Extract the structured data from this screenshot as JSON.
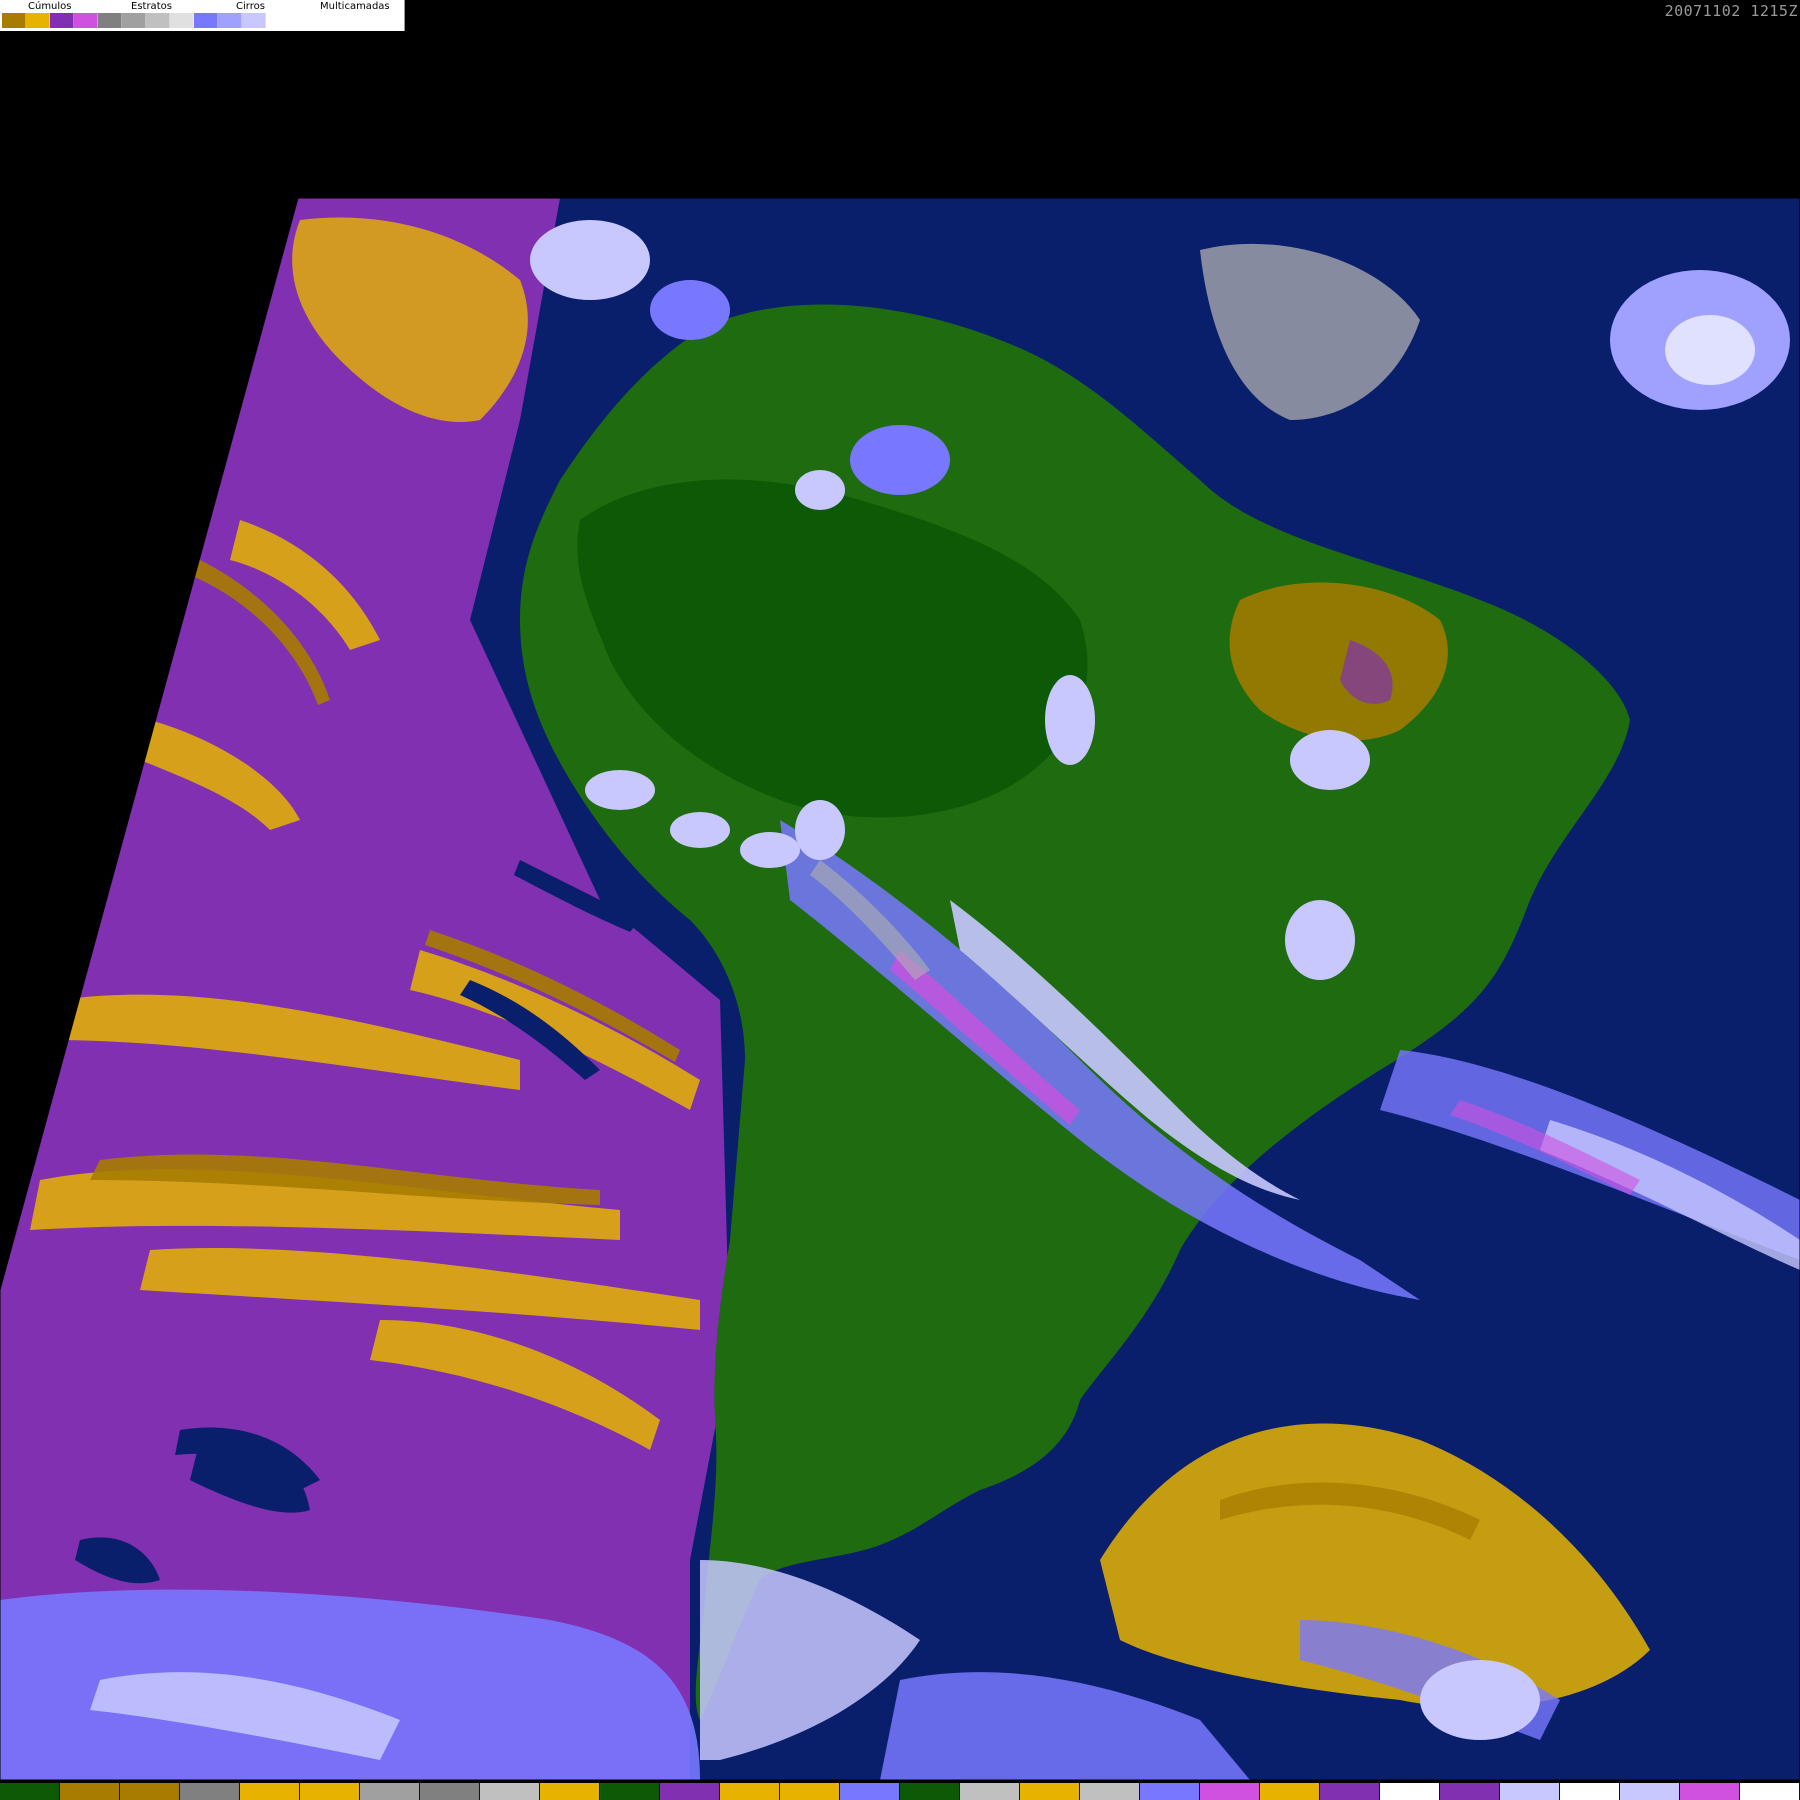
{
  "legend": {
    "groups": [
      {
        "label": "Cúmulos",
        "label_key": "cumulos"
      },
      {
        "label": "Estratos",
        "label_key": "estratos"
      },
      {
        "label": "Cirros",
        "label_key": "cirros"
      },
      {
        "label": "Multicamadas",
        "label_key": "multicamadas"
      }
    ],
    "swatches": [
      {
        "category": "cumulos",
        "color": "#a77c00"
      },
      {
        "category": "cumulos",
        "color": "#e6b400"
      },
      {
        "category": "estratos",
        "color": "#8030b0"
      },
      {
        "category": "estratos",
        "color": "#d050e0"
      },
      {
        "category": "cirros",
        "color": "#808080"
      },
      {
        "category": "cirros",
        "color": "#a0a0a0"
      },
      {
        "category": "cirros",
        "color": "#c0c0c0"
      },
      {
        "category": "cirros",
        "color": "#e0e0e0"
      },
      {
        "category": "multicamadas",
        "color": "#7878ff"
      },
      {
        "category": "multicamadas",
        "color": "#a0a0ff"
      },
      {
        "category": "multicamadas",
        "color": "#c8c8ff"
      },
      {
        "category": "multicamadas",
        "color": "#ffffff"
      }
    ]
  },
  "timestamp": "20071102 1215Z",
  "map": {
    "region": "South America satellite cloud classification",
    "colors": {
      "background": "#000000",
      "ocean": "#0a1f6b",
      "land": "#1f6b10",
      "land_dark": "#0d5a06",
      "stratus": "#8030b0",
      "cumulus_low": "#a77c00",
      "cumulus": "#e6b400",
      "multilayer": "#7878ff",
      "multilayer_light": "#c8c8ff",
      "cirrus": "#b0b0b0"
    }
  },
  "bottom_strip": {
    "colors": [
      "#0d5a06",
      "#a77c00",
      "#a77c00",
      "#808080",
      "#e6b400",
      "#e6b400",
      "#a0a0a0",
      "#808080",
      "#c0c0c0",
      "#e6b400",
      "#0d5a06",
      "#8030b0",
      "#e6b400",
      "#e6b400",
      "#7878ff",
      "#0d5a06",
      "#c0c0c0",
      "#e6b400",
      "#c0c0c0",
      "#7878ff",
      "#d050e0",
      "#e6b400",
      "#8030b0",
      "#ffffff",
      "#8030b0",
      "#c8c8ff",
      "#ffffff",
      "#c8c8ff",
      "#d050e0",
      "#ffffff"
    ]
  }
}
